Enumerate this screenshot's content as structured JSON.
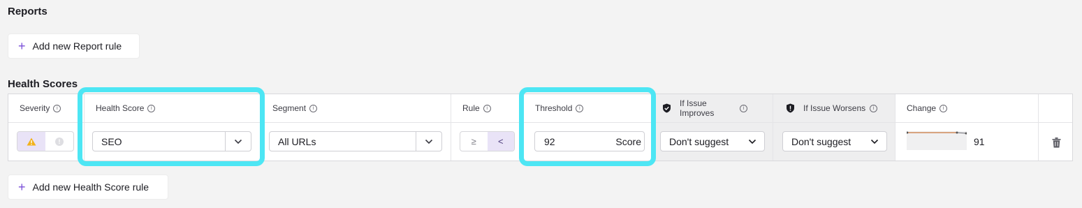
{
  "reports": {
    "title": "Reports",
    "add_button": "Add new Report rule"
  },
  "health_scores": {
    "title": "Health Scores",
    "add_button": "Add new Health Score rule",
    "columns": {
      "severity": "Severity",
      "health_score": "Health Score",
      "segment": "Segment",
      "rule": "Rule",
      "threshold": "Threshold",
      "if_improves": "If Issue Improves",
      "if_worsens": "If Issue Worsens",
      "change": "Change"
    },
    "row": {
      "health_score_value": "SEO",
      "segment_value": "All URLs",
      "rule_gte": "≥",
      "rule_lt": "<",
      "rule_selected": "<",
      "severity_selected": "warning",
      "threshold_value": "92",
      "threshold_unit": "Score",
      "if_improves_value": "Don't suggest",
      "if_worsens_value": "Don't suggest",
      "change_value": "91"
    }
  },
  "colors": {
    "accent": "#7a4fd8",
    "highlight": "#4de6f4",
    "warning": "#f2b21b",
    "sparkline": "#c9763c"
  },
  "icons": [
    "plus-icon",
    "info-icon",
    "warning-icon",
    "circle-icon",
    "chevron-down-icon",
    "shield-check-icon",
    "shield-alert-icon",
    "trash-icon"
  ]
}
